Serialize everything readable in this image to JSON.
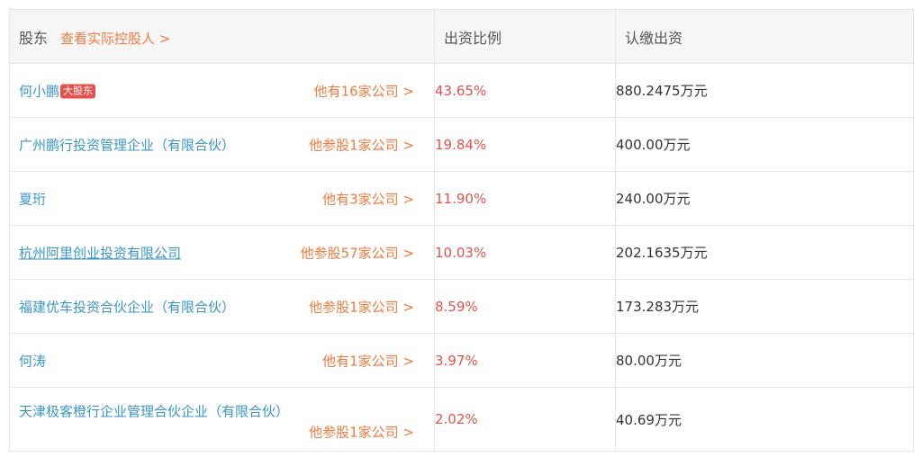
{
  "header": {
    "shareholder": "股东",
    "controller_link": "查看实际控股人 >",
    "ratio": "出资比例",
    "subscribed": "认缴出资"
  },
  "rows": [
    {
      "name": "何小鹏",
      "badge": "大股东",
      "companies": "他有16家公司 >",
      "ratio": "43.65%",
      "amount": "880.2475万元"
    },
    {
      "name": "广州鹏行投资管理企业（有限合伙）",
      "companies": "他参股1家公司 >",
      "ratio": "19.84%",
      "amount": "400.00万元"
    },
    {
      "name": "夏珩",
      "companies": "他有3家公司 >",
      "ratio": "11.90%",
      "amount": "240.00万元"
    },
    {
      "name": "杭州阿里创业投资有限公司",
      "companies": "他参股57家公司 >",
      "ratio": "10.03%",
      "amount": "202.1635万元"
    },
    {
      "name": "福建优车投资合伙企业（有限合伙）",
      "companies": "他参股1家公司 >",
      "ratio": "8.59%",
      "amount": "173.283万元"
    },
    {
      "name": "何涛",
      "companies": "他有1家公司 >",
      "ratio": "3.97%",
      "amount": "80.00万元"
    },
    {
      "name": "天津极客橙行企业管理合伙企业（有限合伙）",
      "companies": "他参股1家公司 >",
      "ratio": "2.02%",
      "amount": "40.69万元"
    }
  ],
  "colors": {
    "link": "#3a96c8",
    "accent": "#f27b3f",
    "ratio": "#e5514c",
    "badge": "#e5514c"
  }
}
